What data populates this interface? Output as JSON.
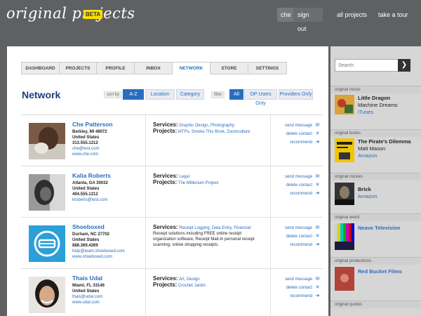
{
  "header": {
    "logo": "original projects",
    "badge": "BETA",
    "user": "che",
    "sign_out": "sign out",
    "all_projects": "all projects",
    "take_tour": "take a tour"
  },
  "tabs": [
    {
      "label": "DASHBOARD",
      "active": false
    },
    {
      "label": "PROJECTS",
      "active": false
    },
    {
      "label": "PROFILE",
      "active": false
    },
    {
      "label": "INBOX",
      "active": false
    },
    {
      "label": "NETWORK",
      "active": true
    },
    {
      "label": "STORE",
      "active": false
    },
    {
      "label": "SETTINGS",
      "active": false
    }
  ],
  "page_title": "Network",
  "sort": {
    "label": "sort by",
    "options": [
      "A-Z",
      "Location",
      "Category"
    ],
    "selected": "A-Z"
  },
  "filter": {
    "label": "filter",
    "options": [
      "All",
      "OP Users Only",
      "Providers Only"
    ],
    "selected": "All"
  },
  "contacts": [
    {
      "name": "Che Patterson",
      "location": "Berkley, MI 48072",
      "country": "United States",
      "phone": "313.555.1212",
      "email": "che@test.com",
      "website": "www.che.com",
      "services_label": "Services:",
      "services": "Graphic Design, Photography",
      "projects_label": "Projects:",
      "projects": "MTPs, Smoke This Book, Zoomculture",
      "description": ""
    },
    {
      "name": "Kalia Roberts",
      "location": "Atlanta, GA 30032",
      "country": "United States",
      "phone": "404.555.1212",
      "email": "kroberts@test.com",
      "website": "",
      "services_label": "Services:",
      "services": "Legal",
      "projects_label": "Projects:",
      "projects": "The Millenium Project",
      "description": ""
    },
    {
      "name": "Shoeboxed",
      "location": "Durham, NC 27702",
      "country": "United States",
      "phone": "888.369.4269",
      "email": "help@team.shoeboxed.com",
      "website": "www.shoeboxed.com",
      "services_label": "Services:",
      "services": "Receipt Logging, Data Entry, Financial",
      "projects_label": "",
      "projects": "",
      "description": "Receipt solutions including FREE online receipt organization software, Receipt Mail-In personal receipt scanning, online shopping receipts."
    },
    {
      "name": "Thais Udal",
      "location": "Miami, FL 33146",
      "country": "United States",
      "phone": "",
      "email": "thais@udal.com",
      "website": "www.udal.com",
      "services_label": "Services:",
      "services": "Art, Design",
      "projects_label": "Projects:",
      "projects": "Crochet Jardin",
      "description": ""
    }
  ],
  "contact_actions": {
    "send_message": "send message",
    "delete_contact": "delete contact",
    "recommend": "recommend"
  },
  "search": {
    "placeholder": "Search",
    "button_icon": "arrow-right-icon"
  },
  "sidebar": {
    "music": {
      "head": "original music",
      "title": "Little Dragon",
      "sub": "Machine Dreams",
      "link": "iTunes"
    },
    "books": {
      "head": "original books",
      "title": "The Pirate's Dilemma",
      "sub": "Matt Mason",
      "link": "Amazon"
    },
    "movies": {
      "head": "original movies",
      "title": "Brick",
      "link": "Amazon"
    },
    "weird": {
      "head": "original weird",
      "link": "Neave Television"
    },
    "productions": {
      "head": "original productions",
      "link": "Red Bucket Films"
    },
    "quotes": {
      "head": "original quotes"
    }
  },
  "colors": {
    "accent": "#2a6dbf",
    "header_bg": "#5f6062",
    "badge": "#ffe000",
    "title": "#1c3f7a"
  }
}
